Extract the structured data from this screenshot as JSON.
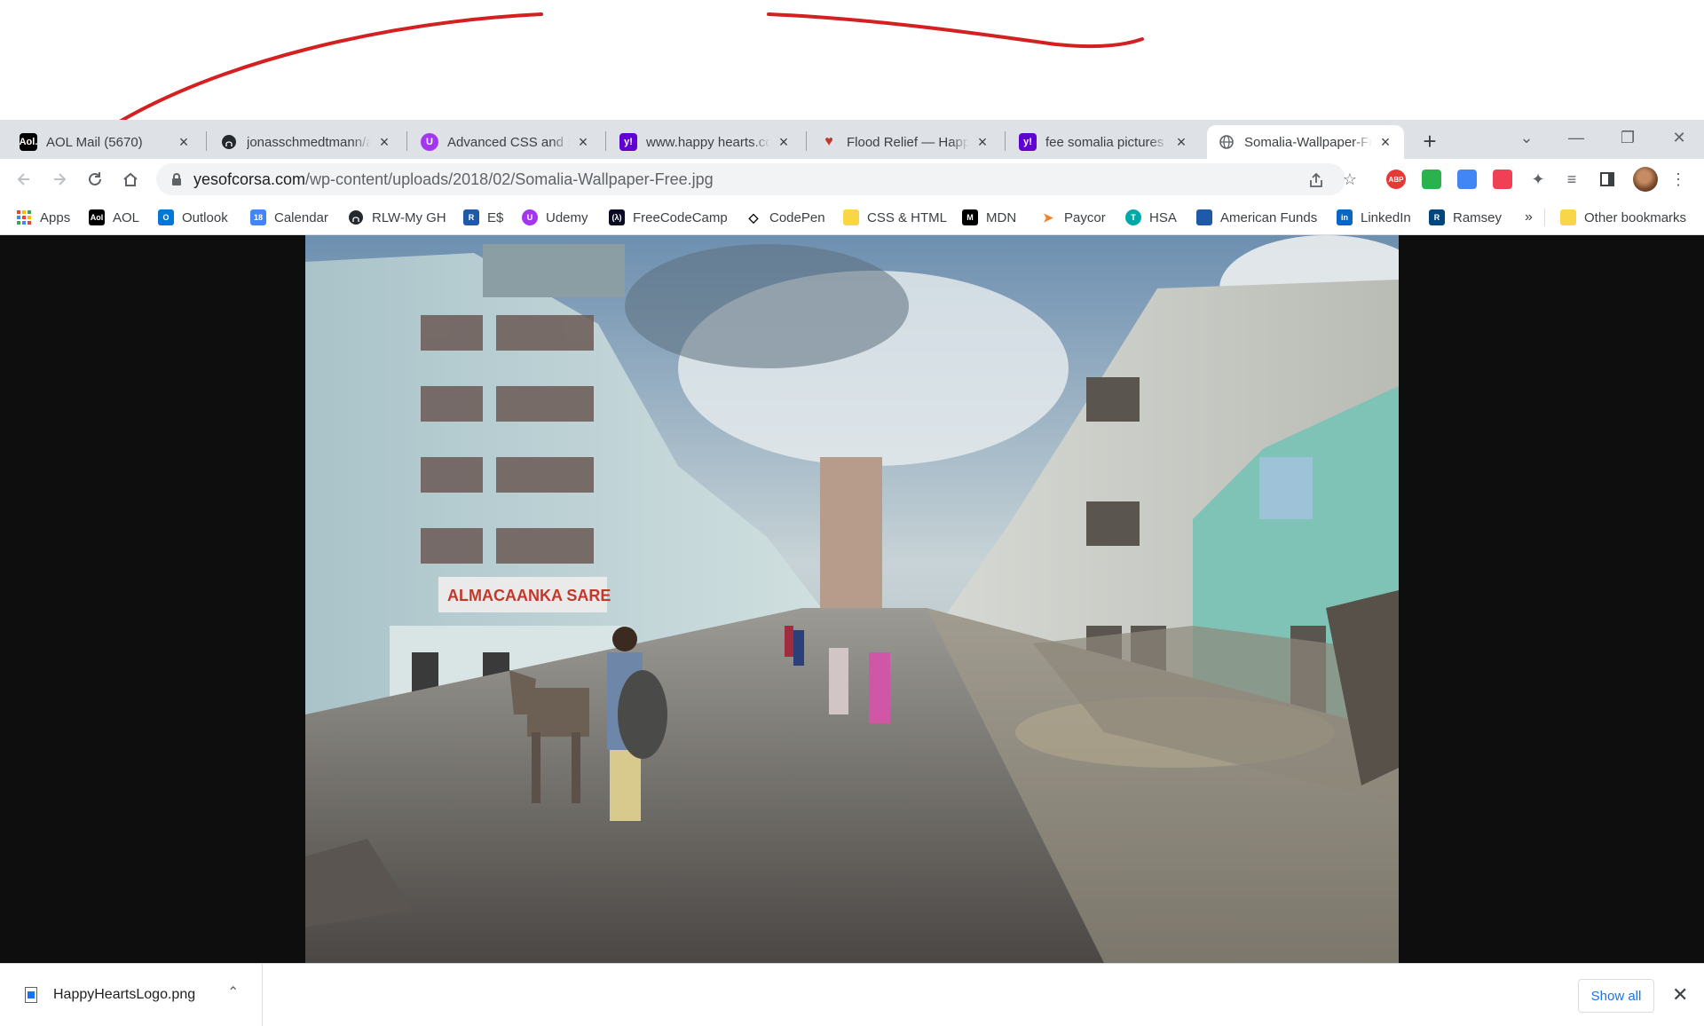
{
  "annotation": {
    "stroke_color": "#d42020"
  },
  "tabs": [
    {
      "title": "AOL Mail (5670)",
      "icon": "aol-icon",
      "icon_text": "Aol.",
      "icon_color": "#000000"
    },
    {
      "title": "jonasschmedtmann/a",
      "icon": "github-icon",
      "icon_text": "",
      "icon_color": "#24292e"
    },
    {
      "title": "Advanced CSS and Sa",
      "icon": "udemy-icon",
      "icon_text": "U",
      "icon_color": "#a435f0"
    },
    {
      "title": "www.happy hearts.co",
      "icon": "yahoo-icon",
      "icon_text": "y!",
      "icon_color": "#6001d2"
    },
    {
      "title": "Flood Relief — Happy",
      "icon": "heart-icon",
      "icon_text": "♥",
      "icon_color": "#c0392b"
    },
    {
      "title": "fee somalia pictures",
      "icon": "yahoo-icon",
      "icon_text": "y!",
      "icon_color": "#6001d2"
    },
    {
      "title": "Somalia-Wallpaper-Fr",
      "icon": "globe-icon",
      "icon_text": "",
      "icon_color": "#5f6368",
      "active": true
    }
  ],
  "toolbar": {
    "url_host": "yesofcorsa.com",
    "url_path": "/wp-content/uploads/2018/02/Somalia-Wallpaper-Free.jpg"
  },
  "extensions": [
    {
      "name": "abp-icon",
      "text": "ABP",
      "color": "#e53935"
    },
    {
      "name": "feedly-icon",
      "text": "",
      "color": "#2bb24c"
    },
    {
      "name": "extension-blue-icon",
      "text": "",
      "color": "#4285f4"
    },
    {
      "name": "pocket-icon",
      "text": "",
      "color": "#ef4056"
    }
  ],
  "bookmarks": [
    {
      "label": "Apps",
      "icon": "apps-grid-icon",
      "color": "#4285f4",
      "text": ""
    },
    {
      "label": "AOL",
      "icon": "aol-icon",
      "color": "#000000",
      "text": "Aol"
    },
    {
      "label": "Outlook",
      "icon": "outlook-icon",
      "color": "#0078d4",
      "text": "O"
    },
    {
      "label": "Calendar",
      "icon": "calendar-icon",
      "color": "#4285f4",
      "text": "18"
    },
    {
      "label": "RLW-My GH",
      "icon": "github-icon",
      "color": "#24292e",
      "text": ""
    },
    {
      "label": "E$",
      "icon": "r-icon",
      "color": "#1e5aa8",
      "text": "R"
    },
    {
      "label": "Udemy",
      "icon": "udemy-icon",
      "color": "#a435f0",
      "text": "U"
    },
    {
      "label": "FreeCodeCamp",
      "icon": "freecodecamp-icon",
      "color": "#0a0a23",
      "text": "(λ)"
    },
    {
      "label": "CodePen",
      "icon": "codepen-icon",
      "color": "#ffffff",
      "text": "◇"
    },
    {
      "label": "CSS & HTML",
      "icon": "folder-icon",
      "color": "#f9d548",
      "text": ""
    },
    {
      "label": "MDN",
      "icon": "mdn-icon",
      "color": "#000000",
      "text": "M"
    },
    {
      "label": "Paycor",
      "icon": "paycor-icon",
      "color": "#ffffff",
      "text": "➤"
    },
    {
      "label": "HSA",
      "icon": "hsa-icon",
      "color": "#00a8a8",
      "text": "T"
    },
    {
      "label": "American Funds",
      "icon": "american-funds-icon",
      "color": "#1e5aa8",
      "text": ""
    },
    {
      "label": "LinkedIn",
      "icon": "linkedin-icon",
      "color": "#0a66c2",
      "text": "in"
    },
    {
      "label": "Ramsey",
      "icon": "ramsey-icon",
      "color": "#00457c",
      "text": "R"
    }
  ],
  "bookmarks_overflow": "»",
  "other_bookmarks": "Other bookmarks",
  "download": {
    "filename": "HappyHeartsLogo.png",
    "show_all": "Show all"
  }
}
